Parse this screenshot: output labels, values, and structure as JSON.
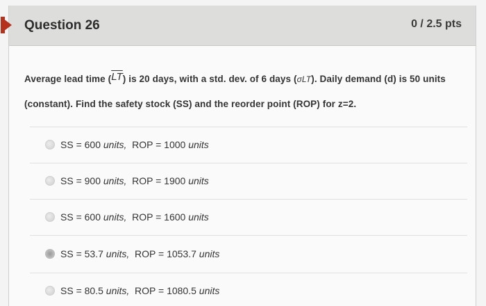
{
  "question": {
    "title": "Question 26",
    "points": "0 / 2.5 pts",
    "text_part1": "Average lead time (",
    "lt_symbol": "LT",
    "text_part2": ") is 20 days, with a std. dev. of 6 days (",
    "sigma_symbol": "σLT",
    "text_part3": "). Daily demand (d) is 50 units (constant). Find the safety stock (SS) and the reorder point (ROP) for z=2."
  },
  "answers": [
    {
      "ss_label": "SS = 600",
      "ss_unit": "units,",
      "rop_label": "ROP = 1000",
      "rop_unit": "units",
      "selected": false
    },
    {
      "ss_label": "SS = 900",
      "ss_unit": "units,",
      "rop_label": "ROP = 1900",
      "rop_unit": "units",
      "selected": false
    },
    {
      "ss_label": "SS = 600",
      "ss_unit": "units,",
      "rop_label": "ROP = 1600",
      "rop_unit": "units",
      "selected": false
    },
    {
      "ss_label": "SS = 53.7",
      "ss_unit": "units,",
      "rop_label": "ROP = 1053.7",
      "rop_unit": "units",
      "selected": true
    },
    {
      "ss_label": "SS = 80.5",
      "ss_unit": "units,",
      "rop_label": "ROP = 1080.5",
      "rop_unit": "units",
      "selected": false
    }
  ],
  "colors": {
    "flag": "#b5321d",
    "header_bg": "#dddddb"
  }
}
